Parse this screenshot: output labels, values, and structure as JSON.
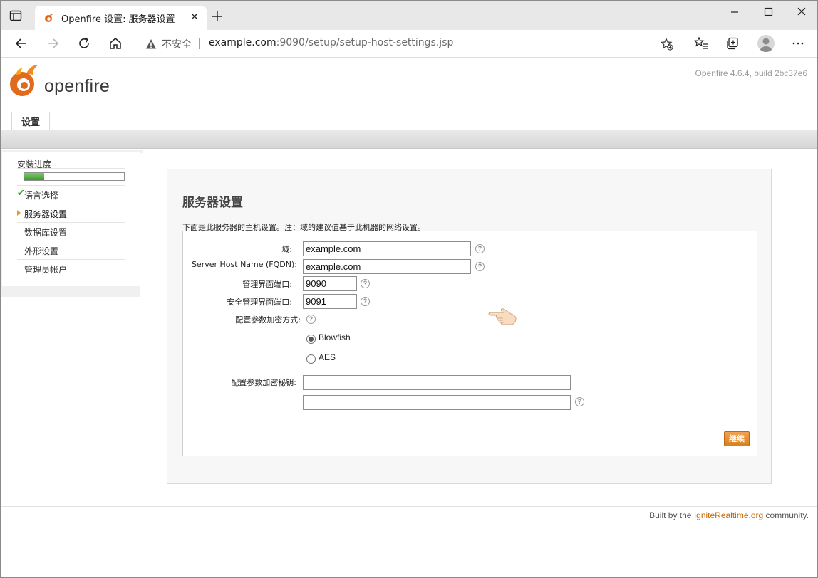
{
  "browser": {
    "tab_title": "Openfire 设置: 服务器设置",
    "security_label": "不安全",
    "url_host": "example.com",
    "url_path": ":9090/setup/setup-host-settings.jsp"
  },
  "header": {
    "logo_text": "openfire",
    "version": "Openfire 4.6.4, build 2bc37e6"
  },
  "nav": {
    "tab_setup": "设置"
  },
  "sidebar": {
    "title": "安装进度",
    "progress": 0.2,
    "items": [
      {
        "label": "语言选择",
        "state": "done"
      },
      {
        "label": "服务器设置",
        "state": "current"
      },
      {
        "label": "数据库设置",
        "state": "pending"
      },
      {
        "label": "外形设置",
        "state": "pending"
      },
      {
        "label": "管理员帐户",
        "state": "pending"
      }
    ]
  },
  "main": {
    "heading": "服务器设置",
    "intro": "下面是此服务器的主机设置。注：域的建议值基于此机器的网络设置。",
    "domain_label": "域:",
    "domain_value": "example.com",
    "fqdn_label": "Server Host Name (FQDN):",
    "fqdn_value": "example.com",
    "admin_port_label": "管理界面端口:",
    "admin_port_value": "9090",
    "secure_port_label": "安全管理界面端口:",
    "secure_port_value": "9091",
    "encryption_label": "配置参数加密方式:",
    "encryption_options": [
      "Blowfish",
      "AES"
    ],
    "encryption_selected": "Blowfish",
    "key_label": "配置参数加密秘钥:",
    "key_value": "",
    "key_confirm_value": "",
    "help_glyph": "?",
    "continue_button": "继续"
  },
  "footer": {
    "prefix": "Built by the ",
    "link": "IgniteRealtime.org",
    "suffix": " community."
  }
}
